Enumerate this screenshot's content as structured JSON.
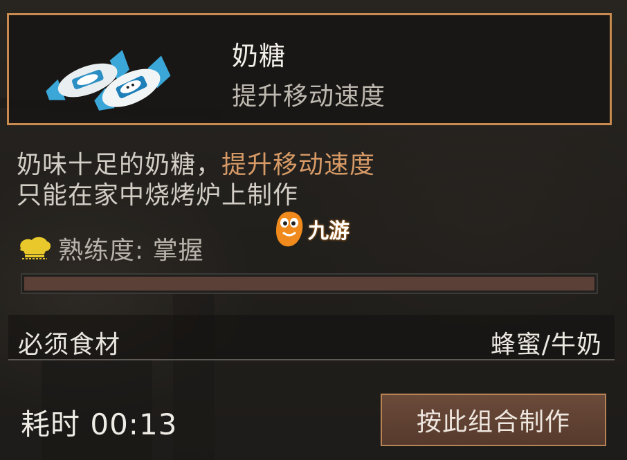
{
  "item": {
    "name": "奶糖",
    "effect": "提升移动速度",
    "icon": "milk-candy-icon"
  },
  "description": {
    "line1_prefix": "奶味十足的奶糖，",
    "line1_highlight": "提升移动速度",
    "line2": "只能在家中烧烤炉上制作"
  },
  "mastery": {
    "icon": "chef-hat-icon",
    "label": "熟练度: 掌握",
    "progress": 1.0
  },
  "ingredients": {
    "label": "必须食材",
    "value": "蜂蜜/牛奶"
  },
  "craft": {
    "time_text": "耗时 00:13",
    "button_label": "按此组合制作"
  },
  "watermark": {
    "text": "九游"
  },
  "colors": {
    "accent_border": "#c88a4f",
    "highlight_text": "#d79a66",
    "progress_fill": "#5b4038",
    "button_bg": "#563a2d"
  }
}
